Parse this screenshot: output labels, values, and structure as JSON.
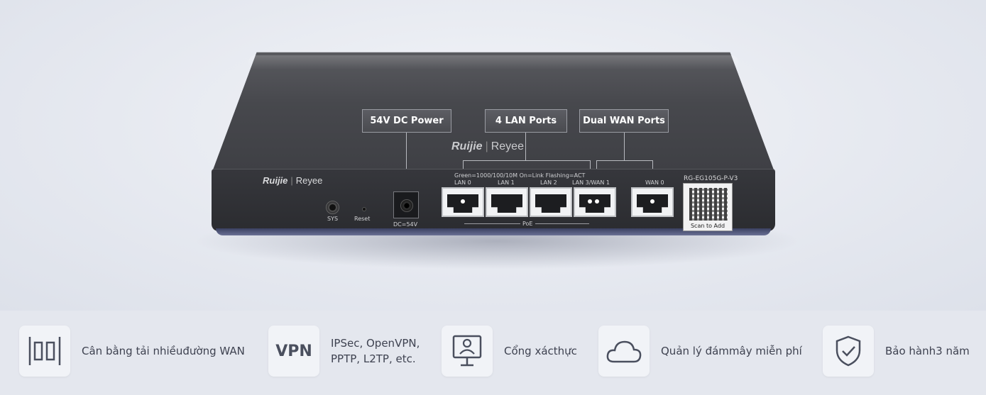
{
  "device": {
    "top_logo_brand": "Ruijie",
    "top_logo_sub": "Reyee",
    "front_logo_brand": "Ruijie",
    "front_logo_sub": "Reyee",
    "model": "RG-EG105G-P-V3",
    "qr_label": "Scan to Add",
    "led_legend": "Green=1000/100/10M  On=Link  Flashing=ACT",
    "poe_label": "PoE",
    "sys_label": "SYS",
    "reset_label": "Reset",
    "dc_label": "DC=54V",
    "ports": [
      {
        "label": "LAN 0"
      },
      {
        "label": "LAN 1"
      },
      {
        "label": "LAN 2"
      },
      {
        "label": "LAN 3/WAN 1"
      },
      {
        "label": "WAN 0"
      }
    ]
  },
  "callouts": {
    "power": "54V DC Power",
    "lan": "4 LAN Ports",
    "wan": "Dual WAN Ports"
  },
  "features": [
    {
      "icon": "load-balance-icon",
      "label": "Cân bằng tải nhiềuđường WAN"
    },
    {
      "icon": "vpn-icon",
      "icon_text": "VPN",
      "label_line1": "IPSec, OpenVPN,",
      "label_line2": "PPTP, L2TP, etc."
    },
    {
      "icon": "portal-kiosk-icon",
      "label": "Cổng xácthực"
    },
    {
      "icon": "cloud-icon",
      "label": "Quản lý đámmây miễn phí"
    },
    {
      "icon": "shield-check-icon",
      "label": "Bảo hành3 năm"
    }
  ]
}
